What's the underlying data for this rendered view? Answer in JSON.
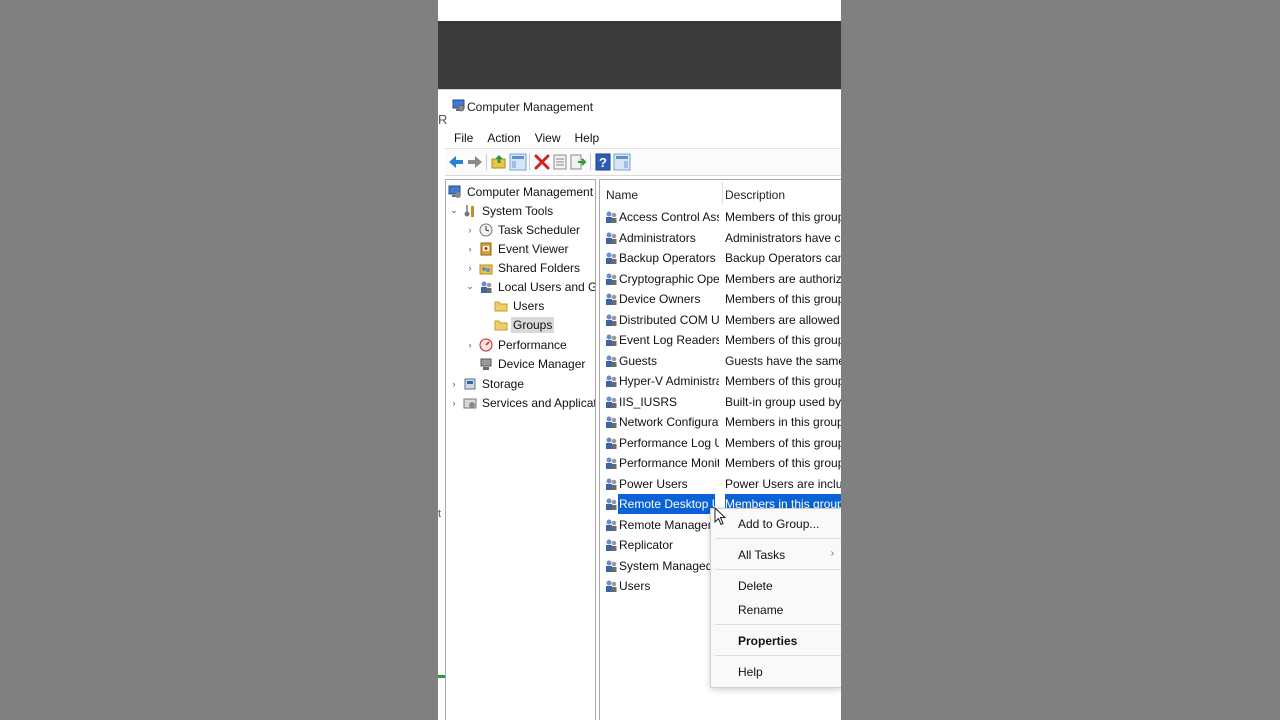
{
  "window": {
    "title": "Computer Management",
    "edge_letter": "R",
    "edge_letter_2": "t"
  },
  "menu": [
    "File",
    "Action",
    "View",
    "Help"
  ],
  "toolbar_icons": [
    "back-arrow-icon",
    "forward-arrow-icon",
    "up-folder-icon",
    "show-hide-console-tree-icon",
    "delete-icon",
    "properties-icon",
    "export-list-icon",
    "help-icon",
    "action-pane-icon"
  ],
  "tree": {
    "root": "Computer Management (PC-WI",
    "system_tools": "System Tools",
    "task_scheduler": "Task Scheduler",
    "event_viewer": "Event Viewer",
    "shared_folders": "Shared Folders",
    "local_users_groups": "Local Users and Groups",
    "users": "Users",
    "groups": "Groups",
    "performance": "Performance",
    "device_manager": "Device Manager",
    "storage": "Storage",
    "services_apps": "Services and Applications"
  },
  "columns": {
    "name": "Name",
    "description": "Description"
  },
  "groups": [
    {
      "name": "Access Control Assista...",
      "desc": "Members of this group can"
    },
    {
      "name": "Administrators",
      "desc": "Administrators have comple"
    },
    {
      "name": "Backup Operators",
      "desc": "Backup Operators can overr"
    },
    {
      "name": "Cryptographic Operat...",
      "desc": "Members are authorized to"
    },
    {
      "name": "Device Owners",
      "desc": "Members of this group can"
    },
    {
      "name": "Distributed COM Users",
      "desc": "Members are allowed to lau"
    },
    {
      "name": "Event Log Readers",
      "desc": "Members of this group can"
    },
    {
      "name": "Guests",
      "desc": "Guests have the same acces"
    },
    {
      "name": "Hyper-V Administrators",
      "desc": "Members of this group have"
    },
    {
      "name": "IIS_IUSRS",
      "desc": "Built-in group used by Inter"
    },
    {
      "name": "Network Configuratio...",
      "desc": "Members in this group can"
    },
    {
      "name": "Performance Log Users",
      "desc": "Members of this group may"
    },
    {
      "name": "Performance Monitor ...",
      "desc": "Members of this group can"
    },
    {
      "name": "Power Users",
      "desc": "Power Users are included fo"
    },
    {
      "name": "Remote Desktop Users",
      "desc": "Members in this group are g"
    },
    {
      "name": "Remote Management",
      "desc": ""
    },
    {
      "name": "Replicator",
      "desc": ""
    },
    {
      "name": "System Managed Acco",
      "desc": ""
    },
    {
      "name": "Users",
      "desc": ""
    }
  ],
  "context_menu": {
    "add_to_group": "Add to Group...",
    "all_tasks": "All Tasks",
    "delete": "Delete",
    "rename": "Rename",
    "properties": "Properties",
    "help": "Help"
  },
  "colors": {
    "selection": "#0a63d6",
    "tree_selection": "#d9d9d9",
    "backdrop": "#808080"
  }
}
